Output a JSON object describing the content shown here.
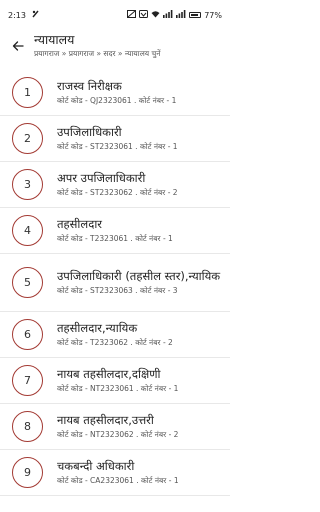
{
  "status_bar": {
    "time": "2:13",
    "battery": "77%",
    "icons": [
      "notification-icon",
      "mute-icon",
      "wifi-icon",
      "vowifi-icon",
      "signal-icon",
      "battery-icon"
    ]
  },
  "header": {
    "title": "न्यायालय",
    "breadcrumb": "प्रयागराज » प्रयागराज » सदर » न्यायालय चुनें"
  },
  "courts": [
    {
      "num": "1",
      "name": "राजस्व निरीक्षक",
      "code": "कोर्ट कोड - QJ2323061 . कोर्ट नंबर - 1"
    },
    {
      "num": "2",
      "name": "उपजिलाधिकारी",
      "code": "कोर्ट कोड - ST2323061 . कोर्ट नंबर - 1"
    },
    {
      "num": "3",
      "name": "अपर उपजिलाधिकारी",
      "code": "कोर्ट कोड - ST2323062 . कोर्ट नंबर - 2"
    },
    {
      "num": "4",
      "name": "तहसीलदार",
      "code": "कोर्ट कोड - T2323061 . कोर्ट नंबर - 1"
    },
    {
      "num": "5",
      "name": "उपजिलाधिकारी (तहसील स्तर),न्यायिक",
      "code": "कोर्ट कोड - ST2323063 . कोर्ट नंबर - 3"
    },
    {
      "num": "6",
      "name": "तहसीलदार,न्यायिक",
      "code": "कोर्ट कोड - T2323062 . कोर्ट नंबर - 2"
    },
    {
      "num": "7",
      "name": "नायब तहसीलदार,दक्षिणी",
      "code": "कोर्ट कोड - NT2323061 . कोर्ट नंबर - 1"
    },
    {
      "num": "8",
      "name": "नायब तहसीलदार,उत्तरी",
      "code": "कोर्ट कोड - NT2323062 . कोर्ट नंबर - 2"
    },
    {
      "num": "9",
      "name": "चकबन्दी अधिकारी",
      "code": "कोर्ट कोड - CA2323061 . कोर्ट नंबर - 1"
    }
  ]
}
